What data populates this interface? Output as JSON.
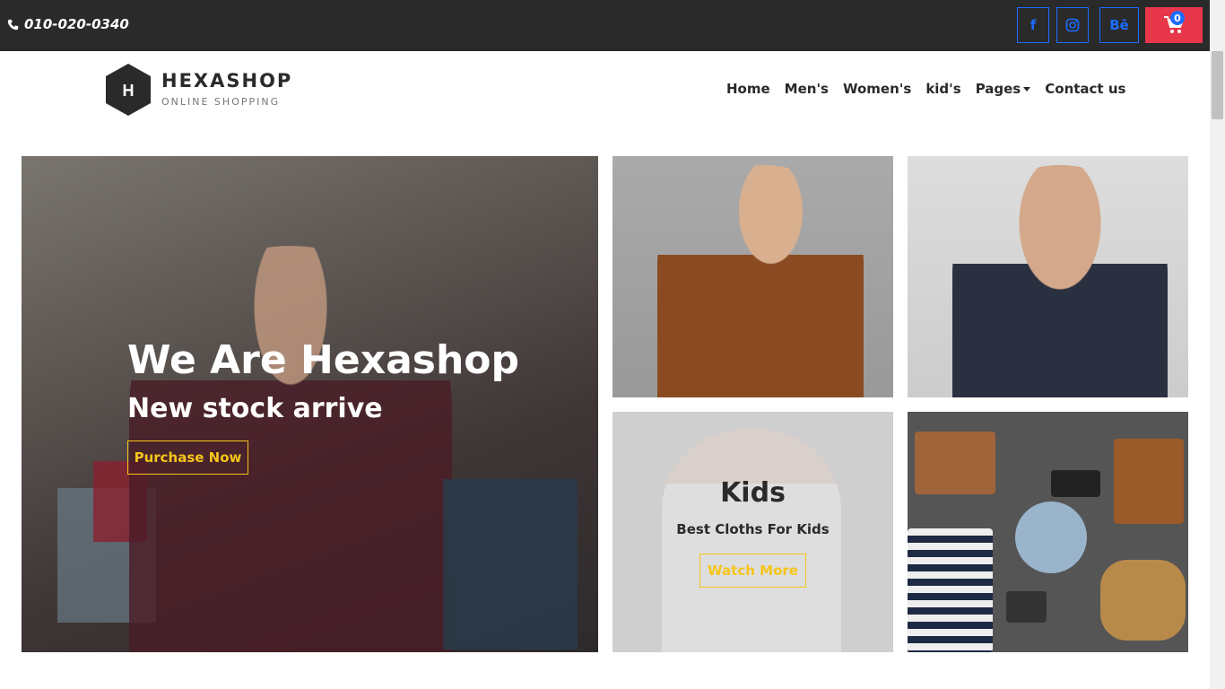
{
  "topbar": {
    "phone": "010-020-0340",
    "social": [
      {
        "name": "facebook-icon",
        "glyph": "f"
      },
      {
        "name": "instagram-icon",
        "glyph": "◎"
      },
      {
        "name": "behance-icon",
        "glyph": "Bē"
      }
    ],
    "cart": {
      "count": "0",
      "icon": "cart-icon"
    }
  },
  "header": {
    "logo_letter": "H",
    "brand": "HEXASHOP",
    "tagline": "ONLINE SHOPPING",
    "nav": [
      "Home",
      "Men's",
      "Women's",
      "kid's",
      "Pages",
      "Contact us"
    ]
  },
  "hero": {
    "title": "We Are Hexashop",
    "subtitle": "New stock arrive",
    "button": "Purchase Now"
  },
  "kids": {
    "title": "Kids",
    "subtitle": "Best Cloths For Kids",
    "button": "Watch More"
  },
  "colors": {
    "accent": "#f5c518",
    "dark": "#2a2a2a",
    "social": "#1a6dff",
    "cart": "#e8374a"
  }
}
